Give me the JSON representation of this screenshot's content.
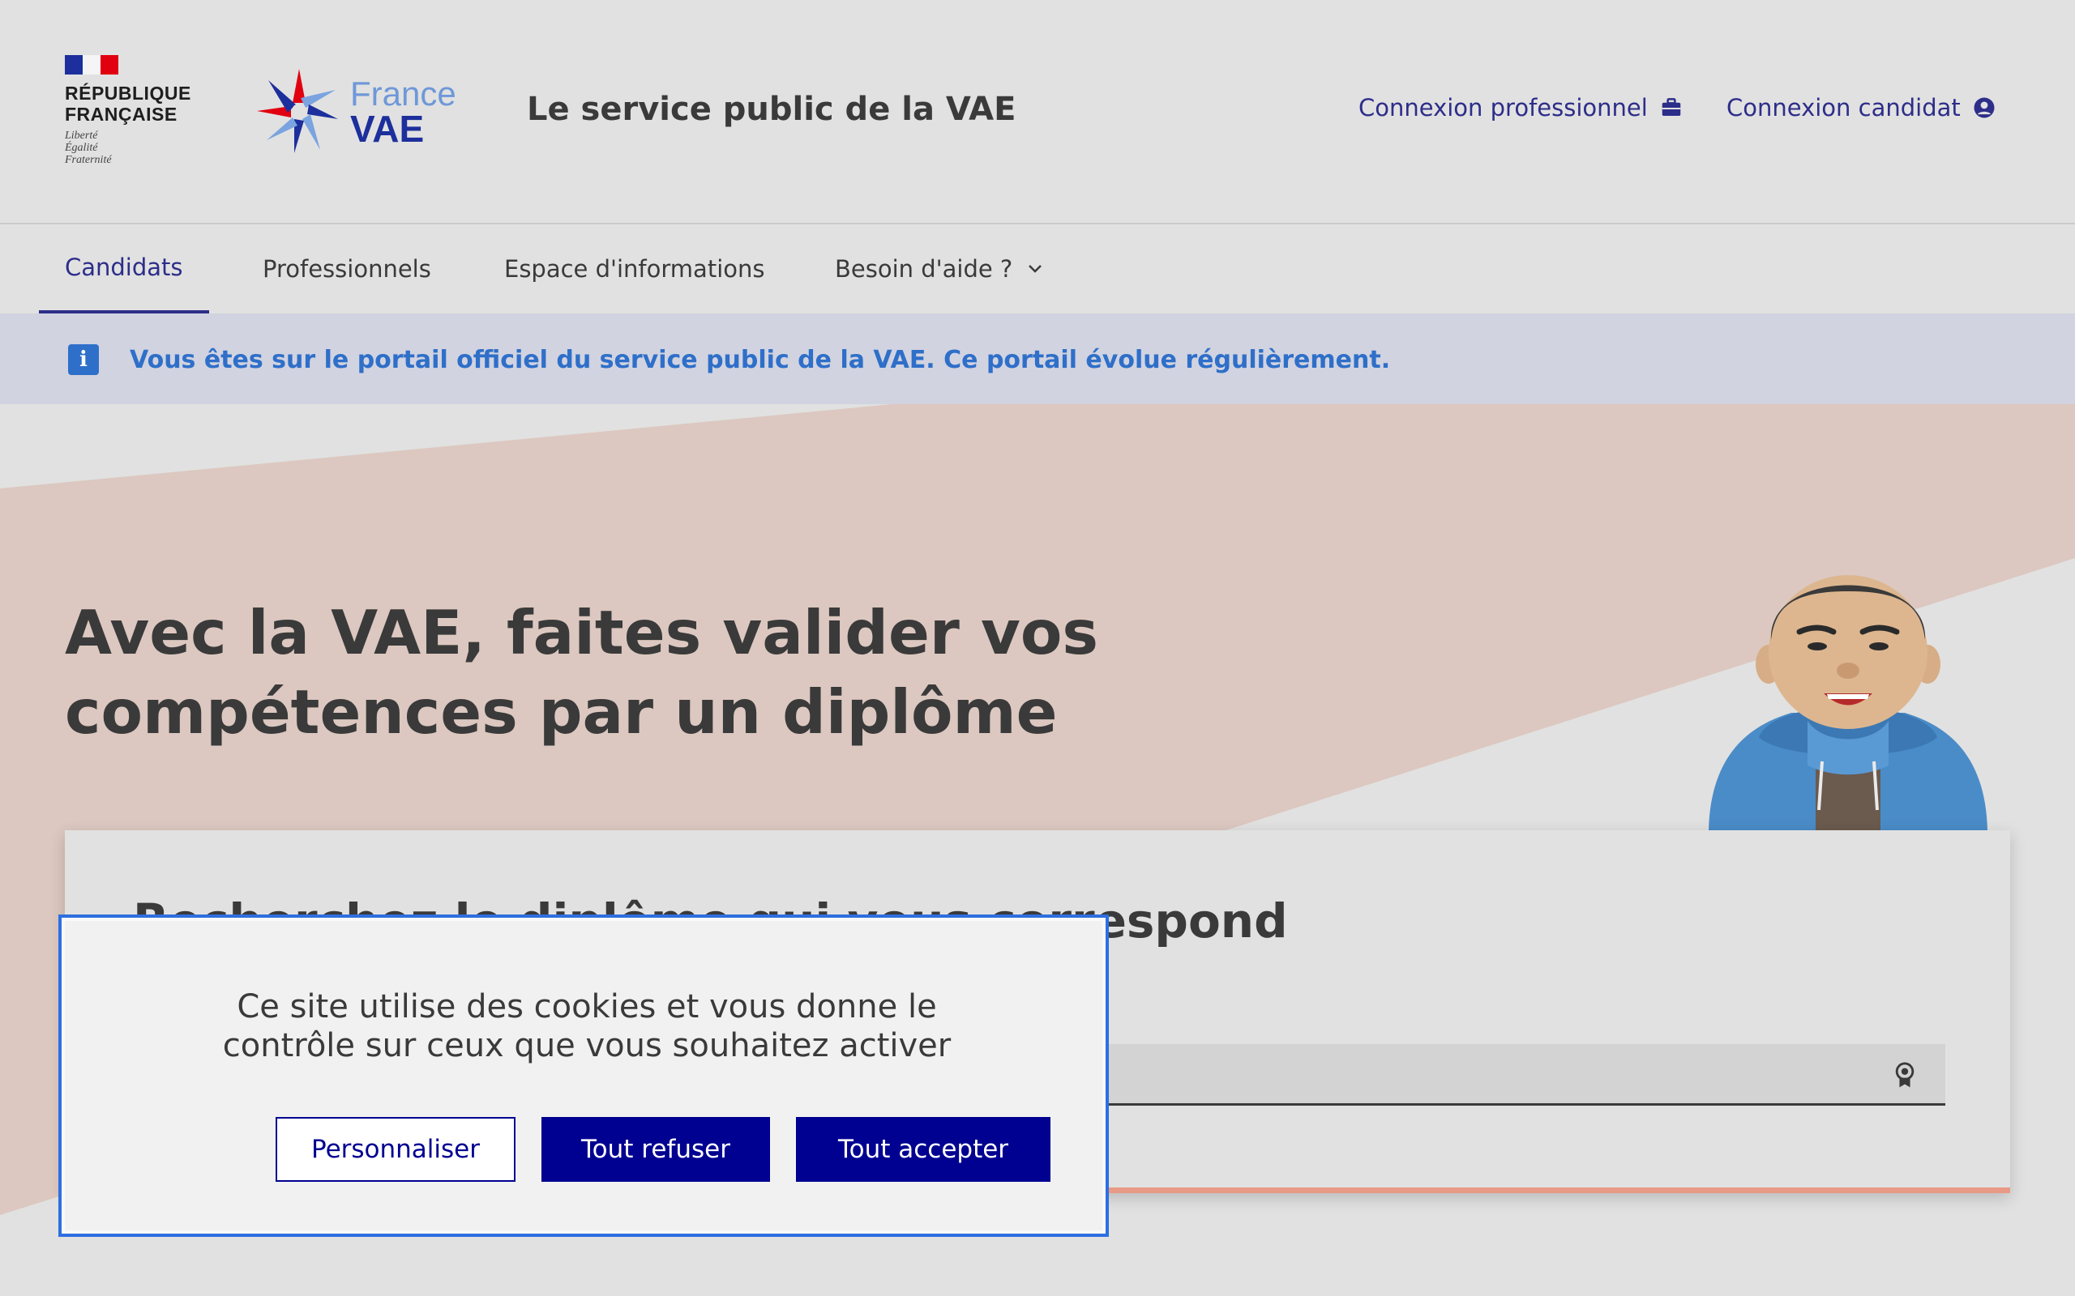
{
  "header": {
    "republique_line1": "RÉPUBLIQUE",
    "republique_line2": "FRANÇAISE",
    "motto": [
      "Liberté",
      "Égalité",
      "Fraternité"
    ],
    "logo_france": "France",
    "logo_vae": "VAE",
    "service_title": "Le service public de la VAE",
    "links": [
      {
        "label": "Connexion professionnel",
        "icon": "briefcase-icon"
      },
      {
        "label": "Connexion candidat",
        "icon": "user-circle-icon"
      }
    ]
  },
  "nav": {
    "items": [
      {
        "label": "Candidats",
        "active": true
      },
      {
        "label": "Professionnels"
      },
      {
        "label": "Espace d'informations"
      },
      {
        "label": "Besoin d'aide ?",
        "icon": "chevron-down-icon"
      }
    ]
  },
  "info_banner": {
    "icon": "info-icon",
    "text": "Vous êtes sur le portail officiel du service public de la VAE. Ce portail évolue régulièrement."
  },
  "hero": {
    "title_line1": "Avec la VAE, faites valider vos",
    "title_line2": "compétences par un diplôme"
  },
  "search": {
    "title": "Recherchez le diplôme qui vous correspond",
    "input_value": "",
    "icon": "award-icon"
  },
  "cookie": {
    "text_line1": "Ce site utilise des cookies et vous donne le",
    "text_line2": "contrôle sur ceux que vous souhaitez activer",
    "buttons": {
      "customize": "Personnaliser",
      "refuse": "Tout refuser",
      "accept": "Tout accepter"
    }
  },
  "colors": {
    "primary": "#000091",
    "link": "#2d2d8a",
    "info": "#2e6fc9",
    "hero_band": "#dcc8c0",
    "accent": "#e99a86"
  }
}
